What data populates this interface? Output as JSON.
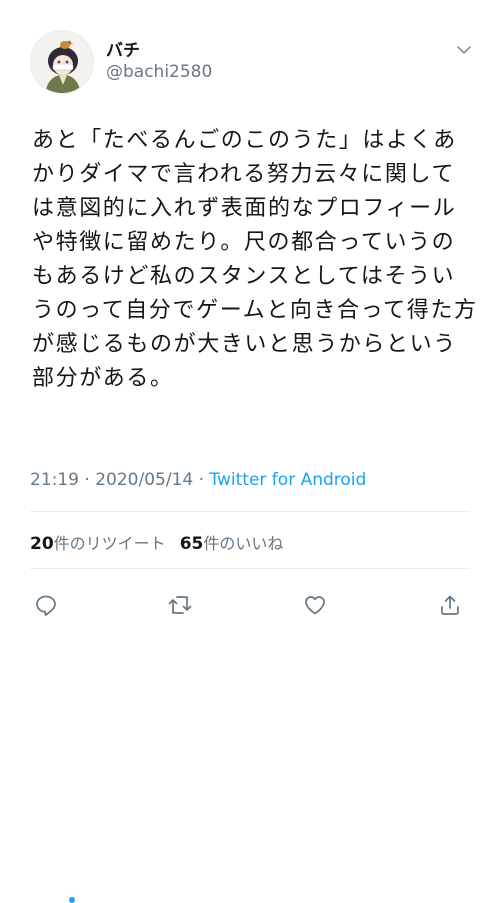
{
  "user": {
    "display_name": "バチ",
    "handle": "@bachi2580"
  },
  "tweet": {
    "text": "あと「たべるんごのこのうた」はよくあかりダイマで言われる努力云々に関しては意図的に入れず表面的なプロフィールや特徴に留めたり。尺の都合っていうのもあるけど私のスタンスとしてはそういうのって自分でゲームと向き合って得た方が感じるものが大きいと思うからという部分がある。",
    "time": "21:19",
    "date": "2020/05/14",
    "separator": " · ",
    "source": "Twitter for Android"
  },
  "stats": {
    "retweets_count": "20",
    "retweets_label": "件のリツイート",
    "likes_count": "65",
    "likes_label": "件のいいね"
  },
  "icons": {
    "menu": "chevron-down-icon",
    "reply": "reply-icon",
    "retweet": "retweet-icon",
    "like": "heart-icon",
    "share": "share-icon"
  },
  "colors": {
    "text": "#14171a",
    "secondary": "#657786",
    "link": "#1da1f2",
    "divider": "#e6ecf0"
  }
}
